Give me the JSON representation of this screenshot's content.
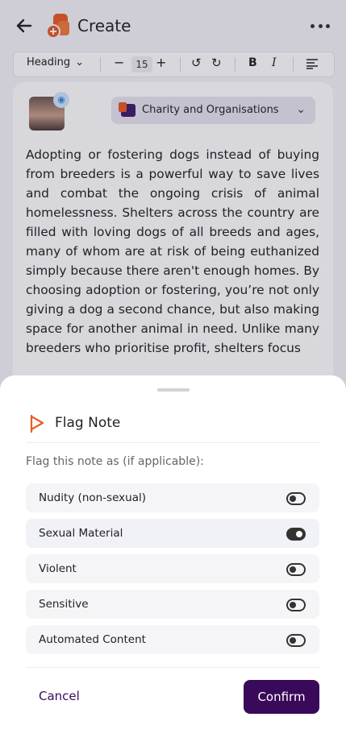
{
  "header": {
    "title": "Create"
  },
  "toolbar": {
    "style_label": "Heading",
    "font_size": "15"
  },
  "editor": {
    "category_label": "Charity and Organisations",
    "note_text": "Adopting or fostering dogs instead of buying from breeders is a powerful way to save lives and combat the ongoing  crisis of animal homelessness. Shelters across the country are filled  with loving dogs of all breeds and ages, many of whom are at risk of  being euthanized simply because there aren't enough homes. By choosing  adoption or fostering, you’re not only giving a dog a second chance, but  also making space for another animal in need. Unlike many breeders who  prioritise profit, shelters focus"
  },
  "sheet": {
    "title": "Flag Note",
    "prompt": "Flag this note as (if applicable):",
    "options": [
      {
        "label": "Nudity (non-sexual)",
        "on": false
      },
      {
        "label": "Sexual Material",
        "on": true
      },
      {
        "label": "Violent",
        "on": false
      },
      {
        "label": "Sensitive",
        "on": false
      },
      {
        "label": "Automated Content",
        "on": false
      }
    ],
    "cancel_label": "Cancel",
    "confirm_label": "Confirm"
  },
  "colors": {
    "brand": "#e85b25",
    "primary": "#3a0a5a"
  },
  "icons": [
    "back-arrow-icon",
    "app-logo-icon",
    "more-icon",
    "chevron-down-icon",
    "undo-icon",
    "redo-icon",
    "bold-icon",
    "italic-icon",
    "align-left-icon",
    "flag-icon",
    "audio-icon",
    "category-icon"
  ]
}
